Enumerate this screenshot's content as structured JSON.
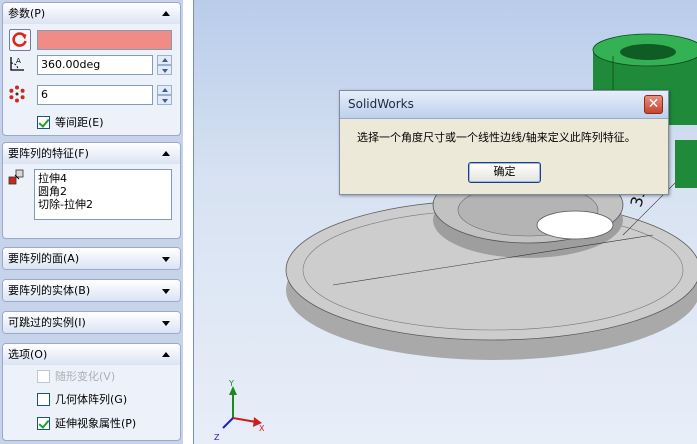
{
  "panel": {
    "params": {
      "header": "参数(P)",
      "angle_value": "360.00deg",
      "count_value": "6",
      "equal_spacing_label": "等间距(E)",
      "equal_spacing_checked": true
    },
    "features": {
      "header": "要阵列的特征(F)",
      "items": [
        "拉伸4",
        "圆角2",
        "切除-拉伸2"
      ]
    },
    "faces": {
      "header": "要阵列的面(A)"
    },
    "bodies": {
      "header": "要阵列的实体(B)"
    },
    "skip": {
      "header": "可跳过的实例(I)"
    },
    "options": {
      "header": "选项(O)",
      "vary_sketch_label": "随形变化(V)",
      "geometry_pattern_label": "几何体阵列(G)",
      "propagate_label": "延伸视象属性(P)"
    }
  },
  "dialog": {
    "title": "SolidWorks",
    "message": "选择一个角度尺寸或一个线性边线/轴来定义此阵列特征。",
    "ok_label": "确定",
    "close_glyph": "✕"
  },
  "viewport": {
    "dimension_text": "35",
    "axes": {
      "x": "X",
      "y": "Y",
      "z": "Z"
    }
  },
  "colors": {
    "error_field": "#f08b85",
    "panel_bg": "#c7d3ea",
    "model_gray": "#b7b7b7",
    "model_green": "#1f8a3a"
  }
}
